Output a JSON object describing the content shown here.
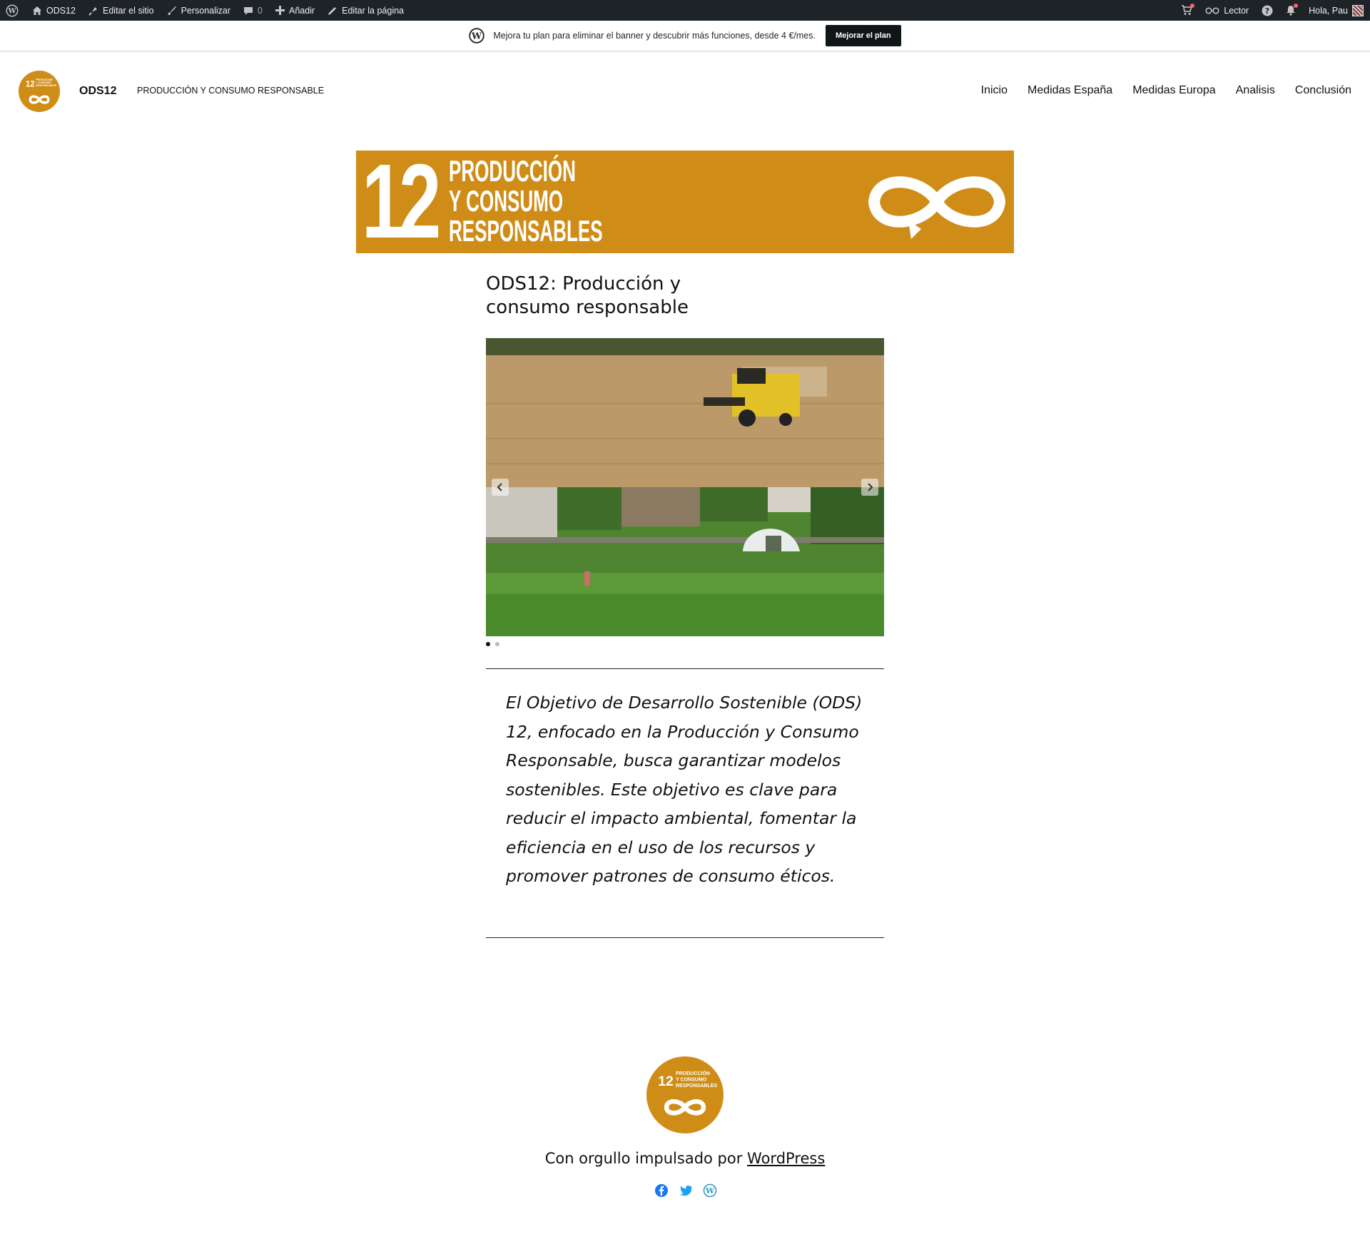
{
  "admin_bar": {
    "site_name": "ODS12",
    "edit_site": "Editar el sitio",
    "customize": "Personalizar",
    "comments_count": "0",
    "add_new": "Añadir",
    "edit_page": "Editar la página",
    "reader": "Lector",
    "greeting": "Hola, Pau"
  },
  "banner": {
    "text": "Mejora tu plan para eliminar el banner y descubrir más funciones, desde 4 €/mes.",
    "button": "Mejorar el plan"
  },
  "header": {
    "site_title": "ODS12",
    "tagline": "PRODUCCIÓN Y CONSUMO RESPONSABLE",
    "nav": [
      "Inicio",
      "Medidas España",
      "Medidas Europa",
      "Analisis",
      "Conclusión"
    ]
  },
  "logo": {
    "number": "12",
    "lines": [
      "PRODUCCIÓN",
      "Y CONSUMO",
      "RESPONSABLES"
    ]
  },
  "hero": {
    "number": "12",
    "lines": [
      "PRODUCCIÓN",
      "Y CONSUMO",
      "RESPONSABLES"
    ]
  },
  "main": {
    "title": "ODS12: Producción y consumo responsable",
    "slider": {
      "slide_count": 2,
      "active_index": 0
    },
    "quote": "El Objetivo de Desarrollo Sostenible (ODS) 12, enfocado en la Producción y Consumo Responsable, busca garantizar modelos sostenibles. Este objetivo es clave para reducir el impacto ambiental, fomentar la eficiencia en el uso de los recursos y promover patrones de consumo éticos."
  },
  "footer": {
    "credit_prefix": "Con orgullo impulsado por ",
    "credit_link": "WordPress",
    "social": [
      "facebook-icon",
      "twitter-icon",
      "wordpress-icon"
    ]
  },
  "colors": {
    "brand": "#cf8d18",
    "admin_bar": "#1d2327",
    "facebook": "#1877f2",
    "twitter": "#1da1f2",
    "wordpress": "#3499cd"
  }
}
